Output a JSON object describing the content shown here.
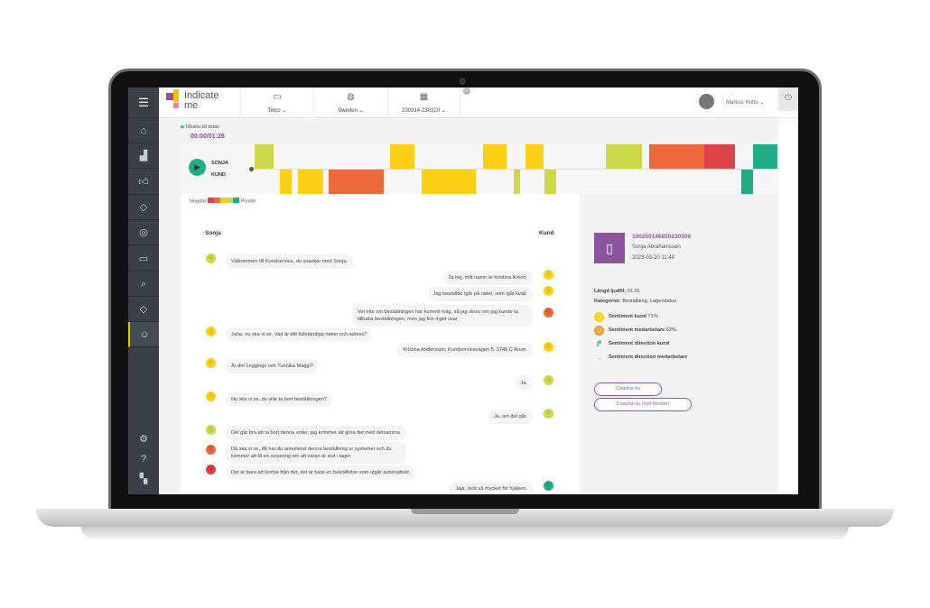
{
  "app": {
    "logo_line1": "Indicate",
    "logo_line2": "me"
  },
  "header": {
    "filters": [
      {
        "label": "Telco",
        "icon": "briefcase-icon"
      },
      {
        "label": "Sweden",
        "icon": "globe-icon"
      },
      {
        "label": "230314-230320",
        "icon": "calendar-icon"
      }
    ],
    "user": "Markus Huttu"
  },
  "sidebar": {
    "items": [
      "menu",
      "home",
      "analytics",
      "thumbs-up",
      "diamond",
      "target",
      "review",
      "search",
      "tag",
      "robot"
    ],
    "bottom": [
      "settings",
      "help",
      "logo"
    ]
  },
  "player": {
    "back_label": "Tilbaka till listan",
    "time": "00:00/01:26",
    "speaker_top": "SONJA",
    "speaker_bottom": "KUND",
    "legend_negative": "Negativ",
    "legend_positive": "Positiv"
  },
  "colors": {
    "lime": "#cdd84a",
    "yellow": "#fdd017",
    "orange": "#ed6a3e",
    "red": "#dc4349",
    "green": "#1fae83",
    "purple": "#8e54a0"
  },
  "chat": {
    "left_header": "Sonja",
    "right_header": "Kund",
    "messages": [
      {
        "side": "left",
        "text": "Välkommen till Kundservice, du snackar med Sonja.",
        "sentiment": "lime"
      },
      {
        "side": "right",
        "text": "Ja hej, mitt namn är Kristina Kroon.",
        "sentiment": "yellow"
      },
      {
        "side": "right",
        "text": "Jag beställde igår på nätet, sent igår kväll.",
        "sentiment": "yellow"
      },
      {
        "side": "right",
        "text": "Vet inte om beställningen har kommit iväg, så jag skrev om jag kunde ta tillbaka beställningen, men jag fick inget svar",
        "sentiment": "orange"
      },
      {
        "side": "left",
        "text": "Jaha, nu ska vi se. Vad är ditt fullständiga namn och adress?",
        "sentiment": "yellow"
      },
      {
        "side": "right",
        "text": "Kristina Andersson, Kundservicevägen 5, 3745 C Arum.",
        "sentiment": "yellow"
      },
      {
        "side": "left",
        "text": "Är det Leggings och Tunnika Maggi?",
        "sentiment": "yellow"
      },
      {
        "side": "right",
        "text": "Ja.",
        "sentiment": "lime"
      },
      {
        "side": "left",
        "text": "Nu ska vi se, du ville ta bort beställningen?",
        "sentiment": "yellow"
      },
      {
        "side": "right",
        "text": "Ja, om det går.",
        "sentiment": "lime"
      },
      {
        "side": "left",
        "text": "Det går bra att ta bort denna order, jag kommer att göra det med detsamma.",
        "sentiment": "lime"
      },
      {
        "side": "left",
        "text": "Då ska vi se, då har du annullerat denna beställning ur systemet och du kommer att få en avisering om att varan är slut i lager.",
        "sentiment": "orange"
      },
      {
        "side": "left",
        "text": "Det är bara att bortse från det, det är bara en bekräftelse som utgår automatiskt.",
        "sentiment": "red"
      },
      {
        "side": "right",
        "text": "Jaja, tack så mycket för hjälpen.",
        "sentiment": "green"
      }
    ]
  },
  "details": {
    "id": "100250146850230306",
    "agent": "Sonja Abrahamsson",
    "datetime": "2023-03-20 11:44",
    "length_label": "Längd ljudfil:",
    "length": "01:26",
    "categories_label": "Kategorier:",
    "categories": "Beställning, Lagerstatus",
    "metrics": [
      {
        "label": "Sentiment kund",
        "value": "71%",
        "icon": "smiley-yellow-icon"
      },
      {
        "label": "Sentiment medarbetare",
        "value": "62%",
        "icon": "smiley-orange-icon"
      },
      {
        "label": "Sentiment direction kund",
        "value": "",
        "icon": "arrow-up-green-icon"
      },
      {
        "label": "Sentiment direction medarbetare",
        "value": "",
        "icon": "arrow-right-yellow-icon"
      }
    ],
    "buttons": [
      "Coacha nu",
      "Coacha nu (nytt fönster)"
    ]
  }
}
